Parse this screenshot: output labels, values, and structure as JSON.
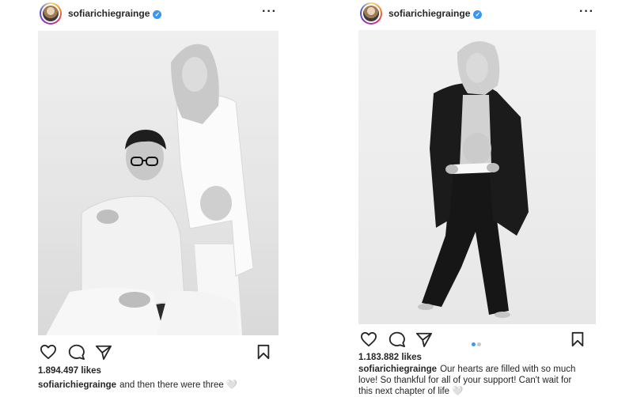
{
  "posts": [
    {
      "username": "sofiarichiegrainge",
      "verified": true,
      "likes": "1.894.497 likes",
      "caption_user": "sofiarichiegrainge",
      "caption_text": "and then there were three",
      "caption_emoji": "🤍",
      "icons": [
        "heart-icon",
        "comment-icon",
        "share-icon",
        "bookmark-icon",
        "more-options-icon"
      ]
    },
    {
      "username": "sofiarichiegrainge",
      "verified": true,
      "likes": "1.183.882 likes",
      "caption_user": "sofiarichiegrainge",
      "caption_text": "Our hearts are filled with so much love! So thankful for all of your support! Can't wait for this next chapter of life",
      "caption_emoji": "🤍",
      "carousel": {
        "total": 2,
        "active": 1
      },
      "icons": [
        "heart-icon",
        "comment-icon",
        "share-icon",
        "bookmark-icon",
        "more-options-icon"
      ]
    }
  ],
  "colors": {
    "verified": "#3897f0",
    "text": "#262626",
    "active_dot": "#3897f0",
    "inactive_dot": "#c7c7c7"
  }
}
